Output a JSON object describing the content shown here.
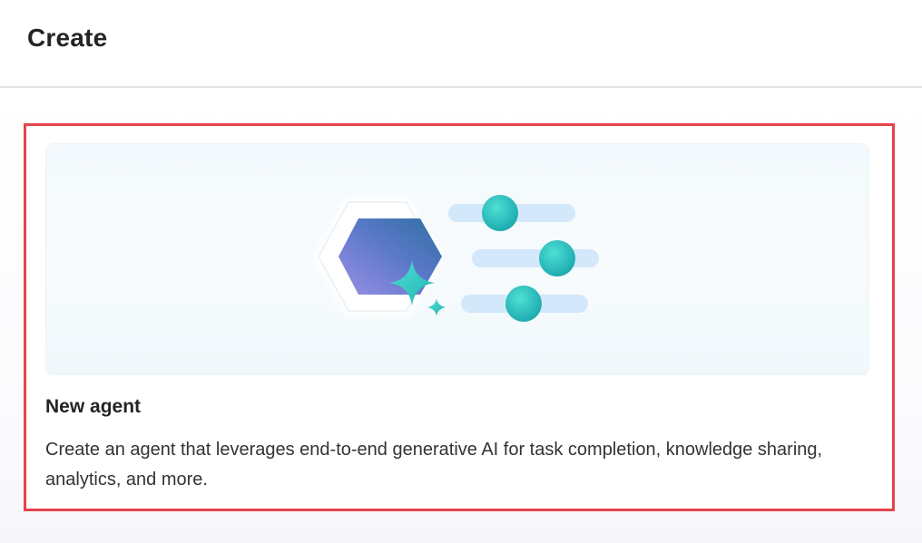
{
  "header": {
    "title": "Create"
  },
  "cards": [
    {
      "title": "New agent",
      "description": "Create an agent that leverages end-to-end generative AI for task completion, knowledge sharing, analytics, and more.",
      "icon": "agent-sliders-illustration"
    }
  ],
  "colors": {
    "highlight_border": "#e5434b",
    "accent_teal": "#2fc7c0",
    "accent_purple": "#7b6fd6",
    "slider_track": "#d3e8fa"
  }
}
